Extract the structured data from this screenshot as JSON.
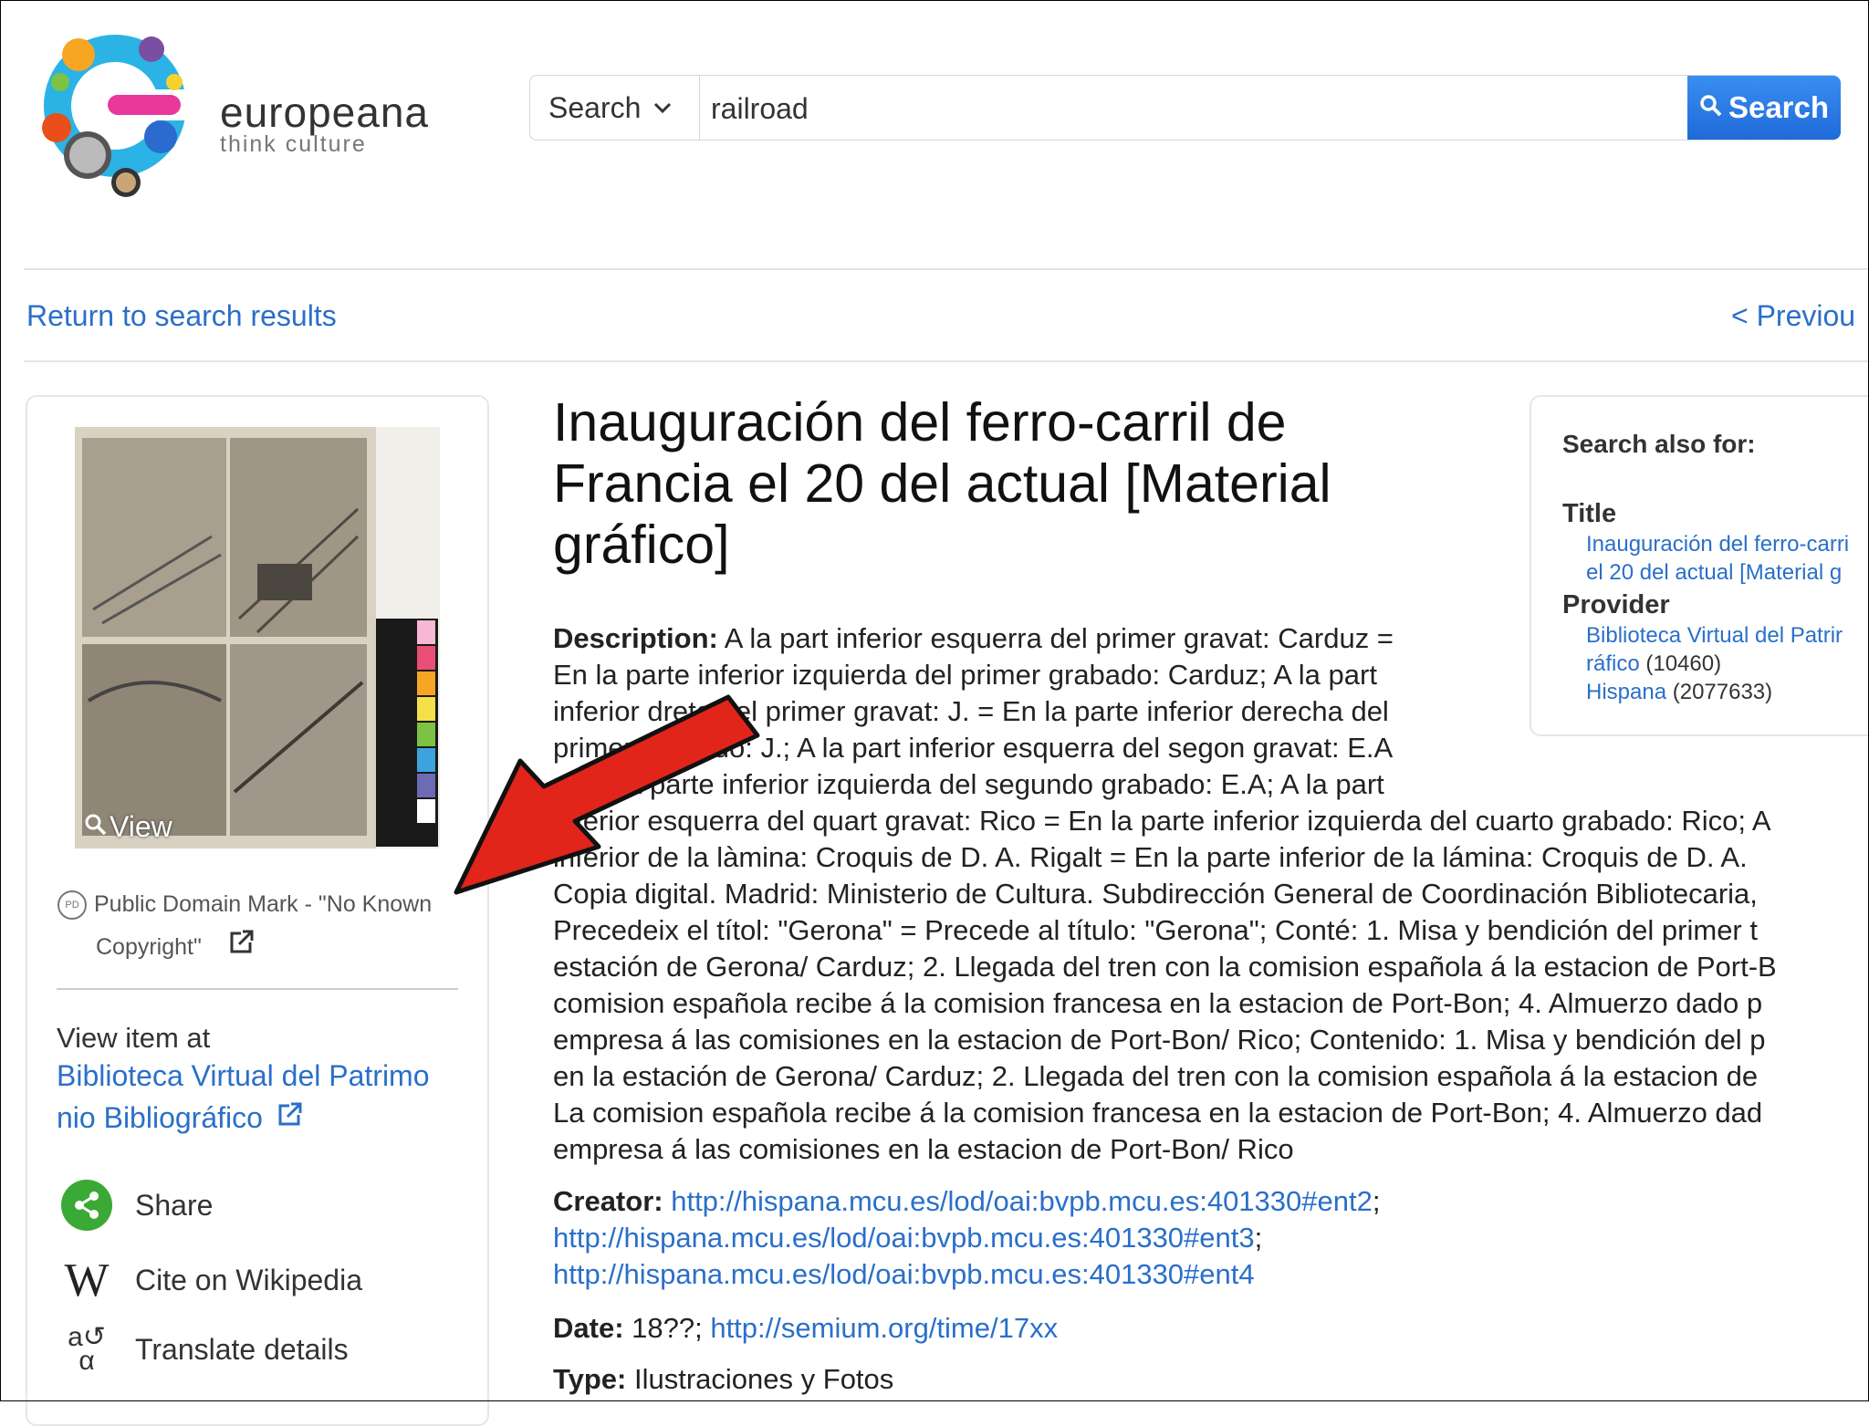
{
  "header": {
    "logo_name": "europeana",
    "logo_tagline": "think culture",
    "search_select_label": "Search",
    "search_query": "railroad",
    "search_button_label": "Search"
  },
  "nav": {
    "return_link": "Return to search results",
    "previous_link": "<  Previou"
  },
  "left_panel": {
    "view_label": "View",
    "rights_line1": "Public Domain Mark - \"No Known",
    "rights_line2": "Copyright\"",
    "pd_badge": "PD",
    "view_item_at": "View item at",
    "provider_line1": "Biblioteca Virtual del Patrimo",
    "provider_line2": "nio Bibliográfico",
    "actions": [
      {
        "label": "Share",
        "icon": "share-icon"
      },
      {
        "label": "Cite on Wikipedia",
        "icon": "wikipedia-icon"
      },
      {
        "label": "Translate details",
        "icon": "translate-icon"
      }
    ]
  },
  "item": {
    "title": "Inauguración del ferro-carril de Francia el 20 del actual [Material gráfico]",
    "description_label": "Description:",
    "description_lines": [
      " A la part inferior esquerra del primer gravat: Carduz =",
      "En la parte inferior izquierda del primer grabado: Carduz; A la part",
      "inferior dreta del primer gravat: J. = En la parte inferior derecha del",
      "primer grabado: J.; A la part inferior esquerra del segon gravat: E.A",
      "= En la parte inferior izquierda del segundo grabado: E.A; A la part",
      "inferior esquerra del quart gravat: Rico = En la parte inferior izquierda del cuarto grabado: Rico; A",
      "inferior de la làmina: Croquis de D. A. Rigalt = En la parte inferior de la lámina: Croquis de D. A.",
      "Copia digital. Madrid: Ministerio de Cultura. Subdirección General de Coordinación Bibliotecaria,",
      "Precedeix el títol: \"Gerona\" = Precede al título: \"Gerona\"; Conté: 1. Misa y bendición del primer t",
      "estación de Gerona/ Carduz; 2. Llegada del tren con la comision española á la estacion de Port-B",
      "comision española recibe á la comision francesa en la estacion de Port-Bon; 4. Almuerzo dado p",
      "empresa á las comisiones en la estacion de Port-Bon/ Rico; Contenido: 1. Misa y bendición del p",
      "en la estación de Gerona/ Carduz; 2. Llegada del tren con la comision española á la estacion de",
      "La comision española recibe á la comision francesa en la estacion de Port-Bon; 4. Almuerzo dad",
      "empresa á las comisiones en la estacion de Port-Bon/ Rico"
    ],
    "creator_label": "Creator:",
    "creator_links": [
      "http://hispana.mcu.es/lod/oai:bvpb.mcu.es:401330#ent2",
      "http://hispana.mcu.es/lod/oai:bvpb.mcu.es:401330#ent3",
      "http://hispana.mcu.es/lod/oai:bvpb.mcu.es:401330#ent4"
    ],
    "date_label": "Date:",
    "date_text": " 18??; ",
    "date_link": "http://semium.org/time/17xx",
    "type_label": "Type:",
    "type_value": " Ilustraciones y Fotos"
  },
  "search_also": {
    "heading": "Search also for:",
    "title_label": "Title",
    "title_line1": "Inauguración del ferro-carri",
    "title_line2": "el 20 del actual [Material g",
    "provider_label": "Provider",
    "provider_line1": "Biblioteca Virtual del Patrir",
    "provider_line2": "ráfico",
    "provider_count": " (10460)",
    "hispana": "Hispana",
    "hispana_count": " (2077633)"
  },
  "colors": {
    "link": "#2a6fc9",
    "search_button": "#2a7be4",
    "share_green": "#3aa935",
    "annotation_arrow": "#e1251b"
  }
}
